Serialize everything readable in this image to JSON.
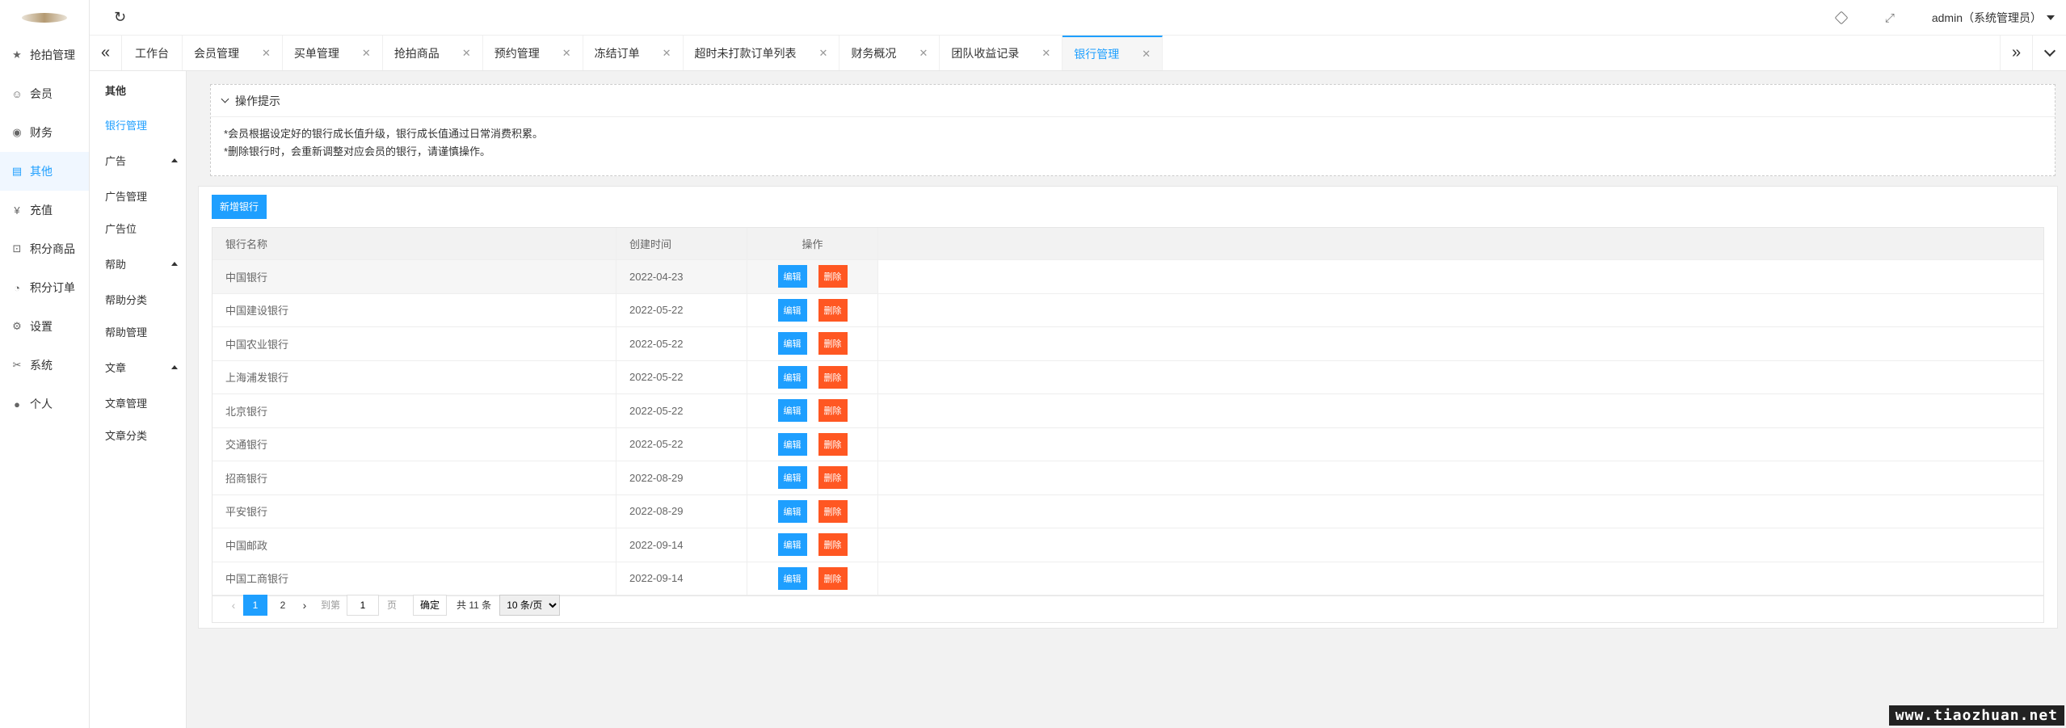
{
  "leftnav": {
    "items": [
      {
        "label": "抢拍管理",
        "icon": "star-icon"
      },
      {
        "label": "会员",
        "icon": "user-icon"
      },
      {
        "label": "财务",
        "icon": "coin-icon"
      },
      {
        "label": "其他",
        "icon": "book-icon",
        "active": true
      },
      {
        "label": "充值",
        "icon": "yen-icon"
      },
      {
        "label": "积分商品",
        "icon": "cart-icon"
      },
      {
        "label": "积分订单",
        "icon": "bell-icon"
      },
      {
        "label": "设置",
        "icon": "gear-icon"
      },
      {
        "label": "系统",
        "icon": "tools-icon"
      },
      {
        "label": "个人",
        "icon": "person-icon"
      }
    ]
  },
  "subnav": {
    "title": "其他",
    "items": {
      "bank": "银行管理",
      "ad_group": "广告",
      "ad_manage": "广告管理",
      "ad_slot": "广告位",
      "help_group": "帮助",
      "help_cat": "帮助分类",
      "help_manage": "帮助管理",
      "article_group": "文章",
      "article_manage": "文章管理",
      "article_cat": "文章分类"
    }
  },
  "header": {
    "admin_label": "admin（系统管理员）"
  },
  "tabs": [
    {
      "label": "工作台"
    },
    {
      "label": "会员管理"
    },
    {
      "label": "买单管理"
    },
    {
      "label": "抢拍商品"
    },
    {
      "label": "预约管理"
    },
    {
      "label": "冻结订单"
    },
    {
      "label": "超时未打款订单列表"
    },
    {
      "label": "财务概况"
    },
    {
      "label": "团队收益记录"
    },
    {
      "label": "银行管理",
      "active": true
    }
  ],
  "tips": {
    "title": "操作提示",
    "line1": "*会员根据设定好的银行成长值升级，银行成长值通过日常消费积累。",
    "line2": "*删除银行时，会重新调整对应会员的银行，请谨慎操作。"
  },
  "toolbar": {
    "add_label": "新增银行"
  },
  "table": {
    "headers": {
      "name": "银行名称",
      "created": "创建时间",
      "action": "操作"
    },
    "edit_label": "编辑",
    "delete_label": "删除",
    "rows": [
      {
        "name": "中国银行",
        "created": "2022-04-23"
      },
      {
        "name": "中国建设银行",
        "created": "2022-05-22"
      },
      {
        "name": "中国农业银行",
        "created": "2022-05-22"
      },
      {
        "name": "上海浦发银行",
        "created": "2022-05-22"
      },
      {
        "name": "北京银行",
        "created": "2022-05-22"
      },
      {
        "name": "交通银行",
        "created": "2022-05-22"
      },
      {
        "name": "招商银行",
        "created": "2022-08-29"
      },
      {
        "name": "平安银行",
        "created": "2022-08-29"
      },
      {
        "name": "中国邮政",
        "created": "2022-09-14"
      },
      {
        "name": "中国工商银行",
        "created": "2022-09-14"
      }
    ]
  },
  "pager": {
    "page1": "1",
    "page2": "2",
    "goto_label": "到第",
    "goto_value": "1",
    "page_unit": "页",
    "ok_label": "确定",
    "total": "共 11 条",
    "page_size": "10 条/页"
  },
  "watermark": "www.tiaozhuan.net",
  "colors": {
    "primary": "#1e9fff",
    "danger": "#ff5722"
  }
}
